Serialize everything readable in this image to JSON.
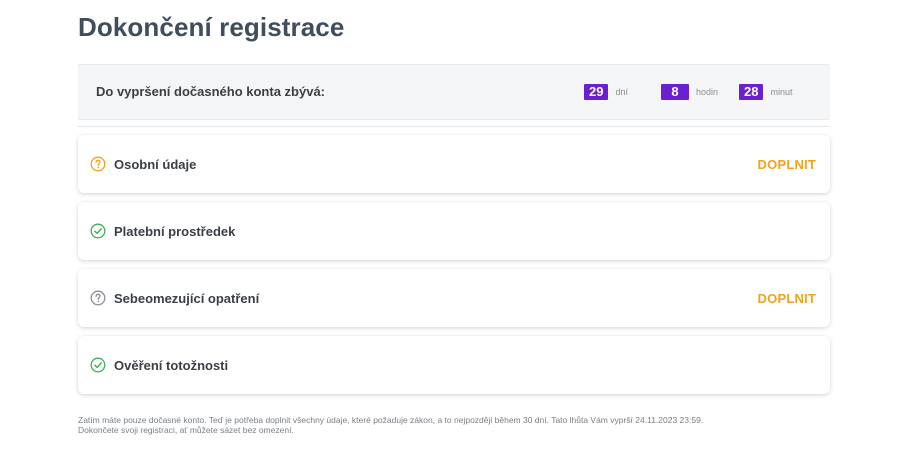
{
  "page": {
    "title": "Dokončení registrace"
  },
  "countdown": {
    "label": "Do vypršení dočasného konta zbývá:",
    "days_value": "29",
    "days_unit": "dní",
    "hours_value": "8",
    "hours_unit": "hodin",
    "minutes_value": "28",
    "minutes_unit": "minut",
    "badge_color": "#6a1fd0"
  },
  "steps": [
    {
      "label": "Osobní údaje",
      "status": "incomplete",
      "icon": "question-circle-icon",
      "icon_color": "#f2a21d",
      "action": "DOPLNIT"
    },
    {
      "label": "Platební prostředek",
      "status": "complete",
      "icon": "check-circle-icon",
      "icon_color": "#3fae5a",
      "action": ""
    },
    {
      "label": "Sebeomezující opatření",
      "status": "pending",
      "icon": "question-circle-icon",
      "icon_color": "#8a8f96",
      "action": "DOPLNIT"
    },
    {
      "label": "Ověření totožnosti",
      "status": "complete",
      "icon": "check-circle-icon",
      "icon_color": "#3fae5a",
      "action": ""
    }
  ],
  "colors": {
    "action": "#f2a21d",
    "title": "#3f4d5c"
  },
  "footer": {
    "line1": "Zatím máte pouze dočasné konto. Teď je potřeba doplnit všechny údaje, které požaduje zákon, a to nejpozději během 30 dní. Tato lhůta Vám vyprší 24.11.2023 23:59.",
    "line2": "Dokončete svoji registraci, ať můžete sázet bez omezení."
  }
}
